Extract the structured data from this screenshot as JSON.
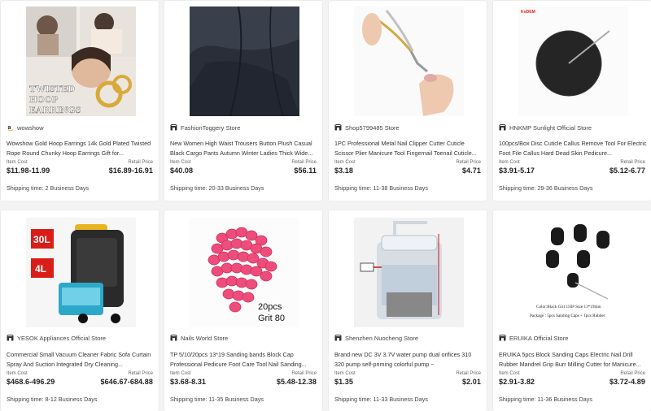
{
  "labels": {
    "item_cost": "Item Cost",
    "retail_price": "Retail Price"
  },
  "products": [
    {
      "store": "wowshow",
      "store_icon": "amazon-icon",
      "title": "Wowshow Gold Hoop Earrings 14k Gold Plated Twisted Rope Round Chunky Hoop Earrings Gift for...",
      "item_cost": "$11.98-11.99",
      "retail_price": "$16.89-16.91",
      "shipping": "Shipping time: 2 Business Days",
      "image_text": [
        "TWISTED",
        "HOOP",
        "EARRINGS"
      ]
    },
    {
      "store": "FashionToggery Store",
      "store_icon": "store-icon",
      "title": "New Women High Waist Trousers Button Plush Casual Black Cargo Pants Autumn Winter Ladies Thick Wide...",
      "item_cost": "$40.08",
      "retail_price": "$56.11",
      "shipping": "Shipping time: 20-33 Business Days"
    },
    {
      "store": "Shop5799485 Store",
      "store_icon": "store-icon",
      "title": "1PC Professional Metal Nail Clipper Cutter Cuticle Scissor Plier Manicure Tool Fingernail Toenail Cuticle...",
      "item_cost": "$3.18",
      "retail_price": "$4.71",
      "shipping": "Shipping time: 11-38 Business Days"
    },
    {
      "store": "HNKMP Sunlight Official Store",
      "store_icon": "store-icon",
      "title": "100pcs/Box Disc Cuticle Callus Remove Tool For Electric Foot File Callus Hard Dead Skin Pedicure...",
      "item_cost": "$3.91-5.17",
      "retail_price": "$5.12-6.77",
      "shipping": "Shipping time: 29-36 Business Days",
      "image_text": [
        "KoDEM"
      ]
    },
    {
      "store": "YESOK Appliances Official Store",
      "store_icon": "store-icon",
      "title": "Commercial Small Vacuum Cleaner Fabric Sofa Curtain Spray And Suction Integrated Dry Cleaning...",
      "item_cost": "$468.6-496.29",
      "retail_price": "$646.67-684.88",
      "shipping": "Shipping time: 8-12 Business Days",
      "image_text": [
        "30L",
        "4L"
      ]
    },
    {
      "store": "Nails World Store",
      "store_icon": "store-icon",
      "title": "TP 5/10/20pcs 13*19 Sanding bands Block Cap Professional Pedicure Foot Care Tool Nail Sanding...",
      "item_cost": "$3.68-8.31",
      "retail_price": "$5.48-12.38",
      "shipping": "Shipping time: 11-35 Business Days",
      "image_text": [
        "20pcs",
        "Grit 80"
      ]
    },
    {
      "store": "Shenzhen Nuocheng Store",
      "store_icon": "store-icon",
      "title": "Brand new DC 3V 3.7V water pump dual orifices 310 320 pump self-priming colorful pump ~",
      "item_cost": "$1.35",
      "retail_price": "$2.01",
      "shipping": "Shipping time: 11-33 Business Days"
    },
    {
      "store": "ERUIKA Official Store",
      "store_icon": "store-icon",
      "title": "ERUIKA 5pcs Block Sanding Caps Electric Nail Drill Rubber Mandrel Grip Burr Milling Cutter for Manicure...",
      "item_cost": "$2.91-3.82",
      "retail_price": "$3.72-4.89",
      "shipping": "Shipping time: 11-36 Business Days",
      "image_text": [
        "Color:Black  Grit:150#  Size:13*19mm",
        "Package : 5pcs Sanding Caps + 1pcs Rubber"
      ]
    }
  ]
}
